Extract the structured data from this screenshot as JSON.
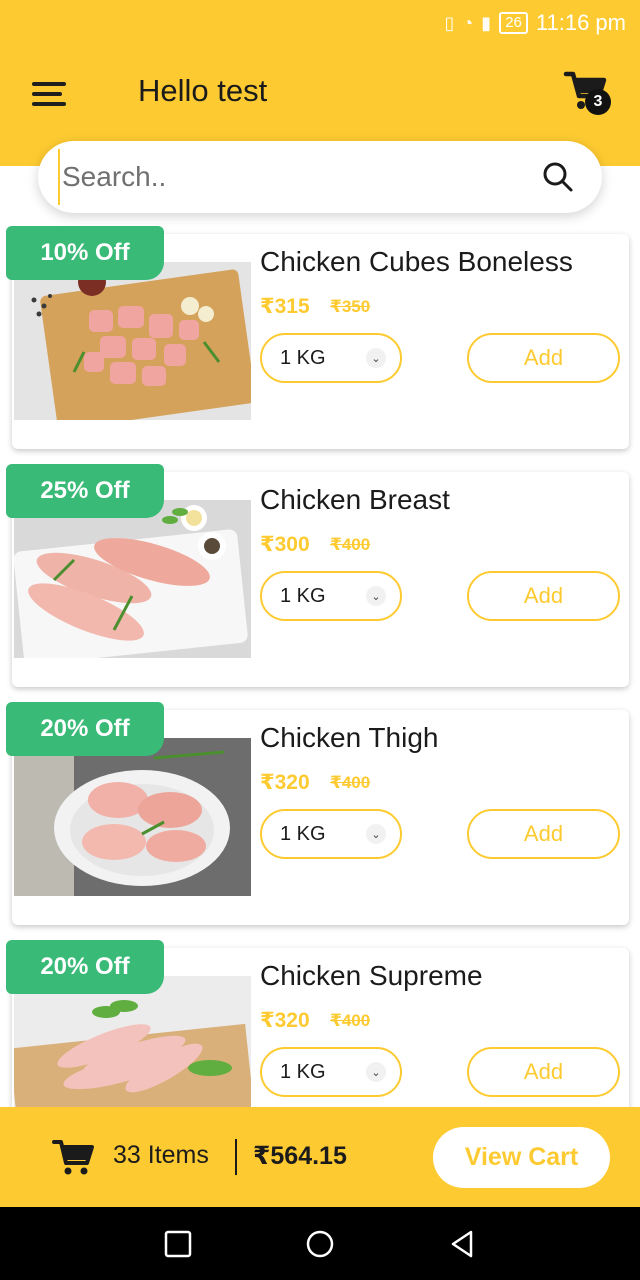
{
  "status": {
    "time": "11:16 pm",
    "battery": "26"
  },
  "header": {
    "greeting": "Hello test",
    "cart_count": "3"
  },
  "search": {
    "placeholder": "Search.."
  },
  "products": [
    {
      "discount": "10% Off",
      "name": "Chicken Cubes Boneless",
      "price": "₹315",
      "mrp": "₹350",
      "qty": "1 KG",
      "add": "Add"
    },
    {
      "discount": "25% Off",
      "name": "Chicken Breast",
      "price": "₹300",
      "mrp": "₹400",
      "qty": "1 KG",
      "add": "Add"
    },
    {
      "discount": "20% Off",
      "name": "Chicken Thigh",
      "price": "₹320",
      "mrp": "₹400",
      "qty": "1 KG",
      "add": "Add"
    },
    {
      "discount": "20% Off",
      "name": "Chicken Supreme",
      "price": "₹320",
      "mrp": "₹400",
      "qty": "1 KG",
      "add": "Add"
    }
  ],
  "footer": {
    "items": "33 Items",
    "total": "₹564.15",
    "view_cart": "View Cart"
  },
  "colors": {
    "accent": "#FDCB31",
    "discount": "#39BA77"
  },
  "icons": [
    "menu-icon",
    "cart-icon",
    "search-icon",
    "chevron-down-icon",
    "square-nav-icon",
    "circle-nav-icon",
    "triangle-back-icon"
  ]
}
